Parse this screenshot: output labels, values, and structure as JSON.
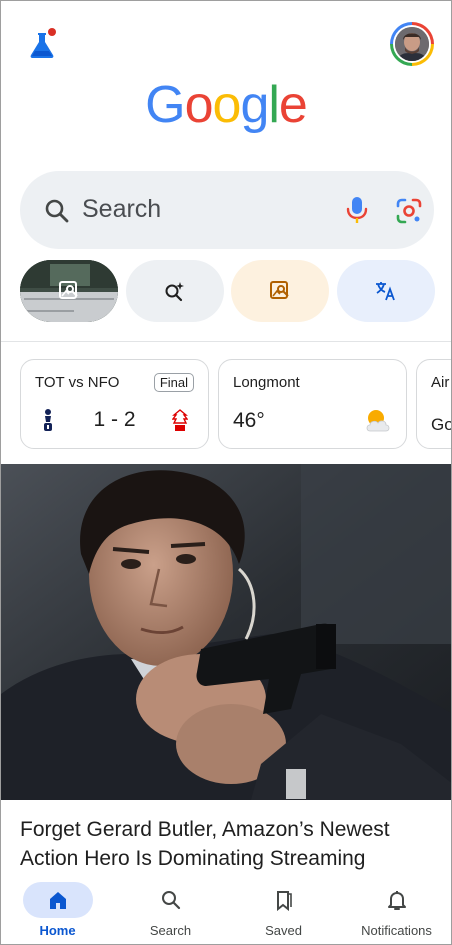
{
  "logo": {
    "letters": [
      "G",
      "o",
      "o",
      "g",
      "l",
      "e"
    ],
    "colors": [
      "#4285f4",
      "#ea4335",
      "#fbbc05",
      "#4285f4",
      "#34a853",
      "#ea4335"
    ]
  },
  "top_bar": {
    "labs_icon": "flask-icon",
    "avatar_icon": "profile-avatar"
  },
  "search": {
    "placeholder": "Search",
    "mic_icon": "mic-icon",
    "lens_icon": "google-lens-icon"
  },
  "chips": [
    {
      "name": "image-search-chip",
      "icon": "image-search-icon"
    },
    {
      "name": "ai-search-chip",
      "icon": "magnify-sparkle-icon"
    },
    {
      "name": "photo-search-chip",
      "icon": "image-search-icon"
    },
    {
      "name": "translate-chip",
      "icon": "translate-icon"
    }
  ],
  "cards": {
    "sport": {
      "title": "TOT vs NFO",
      "badge": "Final",
      "score": "1 - 2"
    },
    "weather": {
      "city": "Longmont",
      "temp": "46°",
      "icon": "partly-cloudy-icon"
    },
    "air": {
      "title": "Air",
      "sub": "Go"
    }
  },
  "news": {
    "headline": "Forget Gerard Butler, Amazon’s Newest Action Hero Is Dominating Streaming"
  },
  "bottom_nav": [
    {
      "label": "Home",
      "icon": "home-icon",
      "active": true
    },
    {
      "label": "Search",
      "icon": "search-icon",
      "active": false
    },
    {
      "label": "Saved",
      "icon": "bookmark-icon",
      "active": false
    },
    {
      "label": "Notifications",
      "icon": "bell-icon",
      "active": false
    }
  ],
  "colors": {
    "accent": "#0b57d0",
    "pill": "#d9e4fc",
    "search_bg": "#edf0f3"
  }
}
